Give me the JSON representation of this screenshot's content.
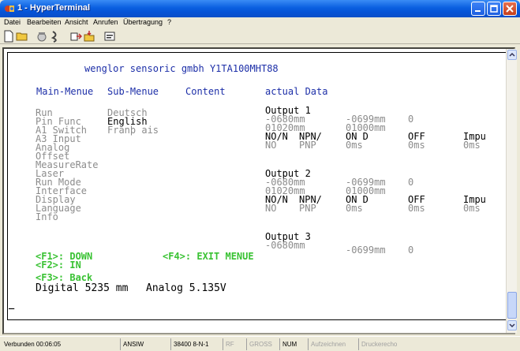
{
  "window": {
    "title": "1 - HyperTerminal",
    "icon": "hyperterminal-phone-icon"
  },
  "menubar": {
    "items": [
      "Datei",
      "Bearbeiten",
      "Ansicht",
      "Anrufen",
      "Übertragung",
      "?"
    ]
  },
  "toolbar": {
    "icons": [
      "new-document-icon",
      "open-folder-icon",
      "connect-icon",
      "disconnect-icon",
      "send-icon",
      "receive-icon",
      "properties-icon"
    ]
  },
  "terminal": {
    "device_title": "wenglor sensoric gmbh Y1TA100MHT88",
    "columns": {
      "main": "Main-Menue",
      "sub": "Sub-Menue",
      "content": "Content",
      "data": "actual Data"
    },
    "main_menu": [
      "Run",
      "Pin Func",
      "A1 Switch",
      "A3 Input",
      "Analog",
      "Offset",
      "MeasureRate",
      "Laser",
      "Run Mode",
      "Interface",
      "Display",
      "Language",
      "Info"
    ],
    "sub_menu": [
      "Deutsch",
      "English",
      "Franþ ais"
    ],
    "sub_menu_active": "English",
    "outputs": [
      {
        "label": "Output 1",
        "row1": [
          "-0680mm",
          "-0699mm",
          "0"
        ],
        "row2": [
          "01020mm",
          "01000mm"
        ],
        "row3": [
          "NO/N",
          "NPN/",
          "ON D",
          "OFF",
          "Impu"
        ],
        "row4": [
          "NO",
          "PNP",
          "0ms",
          "0ms",
          "0ms"
        ]
      },
      {
        "label": "Output 2",
        "row1": [
          "-0680mm",
          "-0699mm",
          "0"
        ],
        "row2": [
          "01020mm",
          "01000mm"
        ],
        "row3": [
          "NO/N",
          "NPN/",
          "ON D",
          "OFF",
          "Impu"
        ],
        "row4": [
          "NO",
          "PNP",
          "0ms",
          "0ms",
          "0ms"
        ]
      },
      {
        "label": "Output 3",
        "row1": [
          "-0680mm",
          "-0699mm",
          "0"
        ]
      }
    ],
    "keys": {
      "f1": "<F1>: DOWN",
      "f2": "<F2>: IN",
      "f3": "<F3>: Back",
      "f4": "<F4>: EXIT MENUE"
    },
    "digital": "Digital 5235 mm",
    "analog": "Analog 5.135V",
    "cursor": "_"
  },
  "statusbar": {
    "connected": "Verbunden 00:06:05",
    "emulation": "ANSIW",
    "port": "38400 8-N-1",
    "rf": "RF",
    "gross": "GROSS",
    "num": "NUM",
    "capture": "Aufzeichnen",
    "print_echo": "Druckerecho"
  },
  "colors": {
    "header_blue": "#1d2fa8",
    "menu_gray": "#8c8c8c",
    "key_green": "#39c233",
    "titlebar_blue": "#0a5fe0"
  }
}
